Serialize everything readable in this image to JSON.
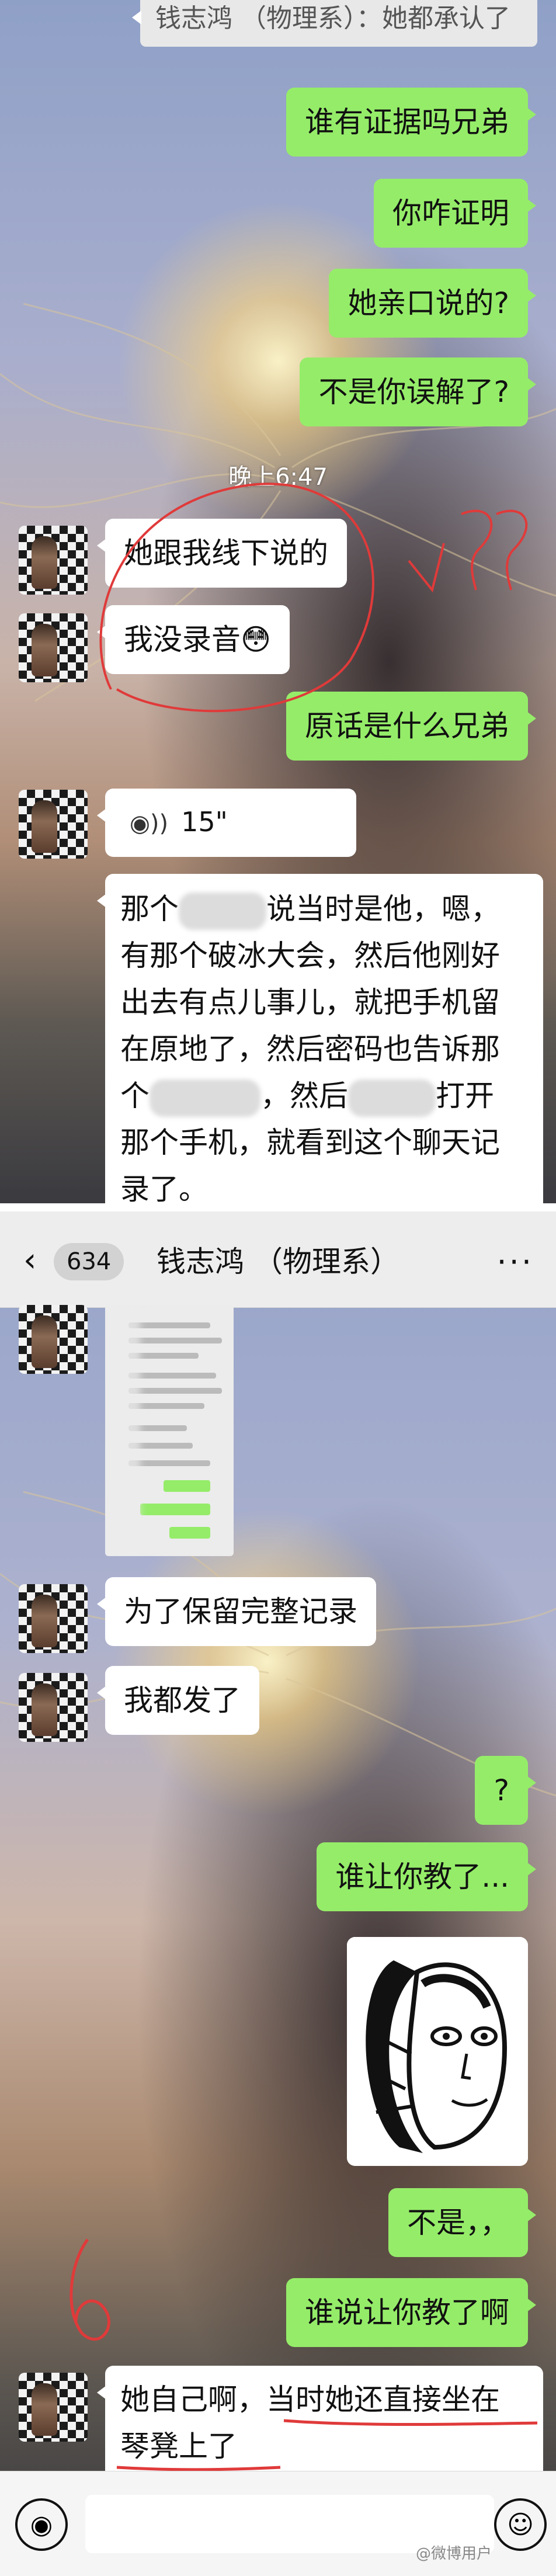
{
  "panel1": {
    "top_reply": "钱志鸿 （物理系）：她都承认了",
    "messages": [
      {
        "side": "right",
        "text": "谁有证据吗兄弟"
      },
      {
        "side": "right",
        "text": "你咋证明"
      },
      {
        "side": "right",
        "text": "她亲口说的?"
      },
      {
        "side": "right",
        "text": "不是你误解了?"
      },
      {
        "side": "left",
        "text": "她跟我线下说的"
      },
      {
        "side": "left",
        "text": "我没录音😳"
      },
      {
        "side": "right",
        "text": "原话是什么兄弟"
      }
    ],
    "timestamp": "晚上6:47",
    "voice_duration": "15\"",
    "transcript": {
      "l1a": "那个",
      "l1b": "说当时是他，嗯，",
      "l2": "有那个破冰大会，然后他刚好",
      "l3": "出去有点儿事儿，就把手机留",
      "l4": "在原地了，然后密码也告诉那",
      "l5a": "个",
      "l5b": "，然后",
      "l5c": "打开",
      "l6": "那个手机，就看到这个聊天记",
      "l7": "录了。"
    },
    "annotation_marks": "??"
  },
  "panel2": {
    "header": {
      "back_icon": "‹",
      "unread_count": "634",
      "title": "钱志鸿 （物理系）",
      "more_icon": "···"
    },
    "messages": [
      {
        "side": "left",
        "text": "为了保留完整记录"
      },
      {
        "side": "left",
        "text": "我都发了"
      },
      {
        "side": "right",
        "text": "?"
      },
      {
        "side": "right",
        "text": "谁让你教了..."
      },
      {
        "side": "right",
        "text": "不是，，"
      },
      {
        "side": "right",
        "text": "谁说让你教了啊"
      }
    ],
    "last_message": {
      "line1": "她自己啊，当时她还直接坐在",
      "line2": "琴凳上了"
    },
    "annotation_mark": "6",
    "input": {
      "voice_icon": "voice-icon",
      "emoji_icon": "☺"
    },
    "watermark": "@微博用户"
  },
  "colors": {
    "green_bubble": "#95ec69",
    "white_bubble": "#ffffff",
    "header": "#ededed",
    "annotation_red": "#e03a3a"
  }
}
